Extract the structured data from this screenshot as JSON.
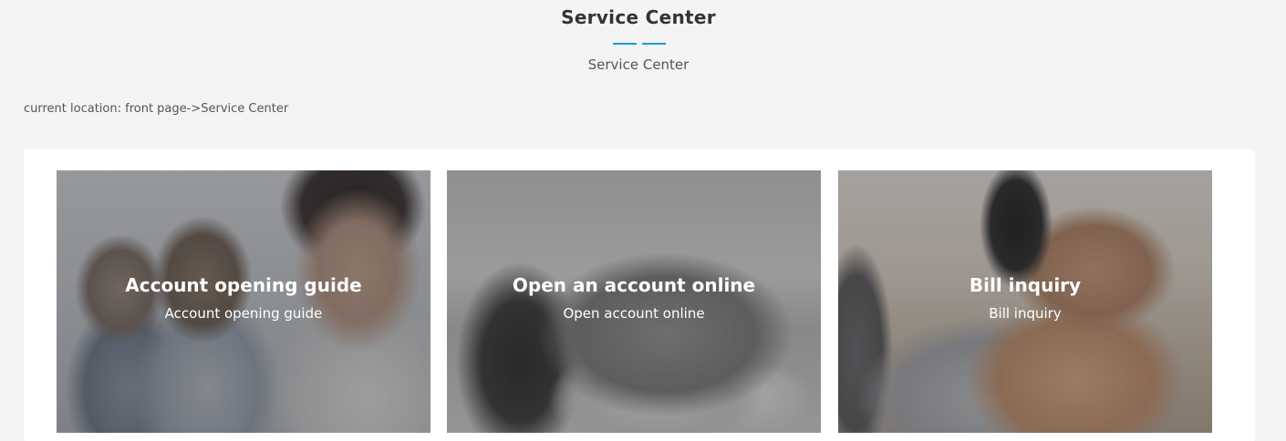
{
  "header": {
    "title": "Service Center",
    "subtitle": "Service Center",
    "accent_color": "#1a9ad6"
  },
  "breadcrumb": {
    "text": "current location: front page->Service Center"
  },
  "cards": [
    {
      "title": "Account opening guide",
      "subtitle": "Account opening guide",
      "image": "call-center-agent-photo"
    },
    {
      "title": "Open an account online",
      "subtitle": "Open account online",
      "image": "office-laptop-photo"
    },
    {
      "title": "Bill inquiry",
      "subtitle": "Bill inquiry",
      "image": "hands-laptop-phone-photo"
    }
  ]
}
